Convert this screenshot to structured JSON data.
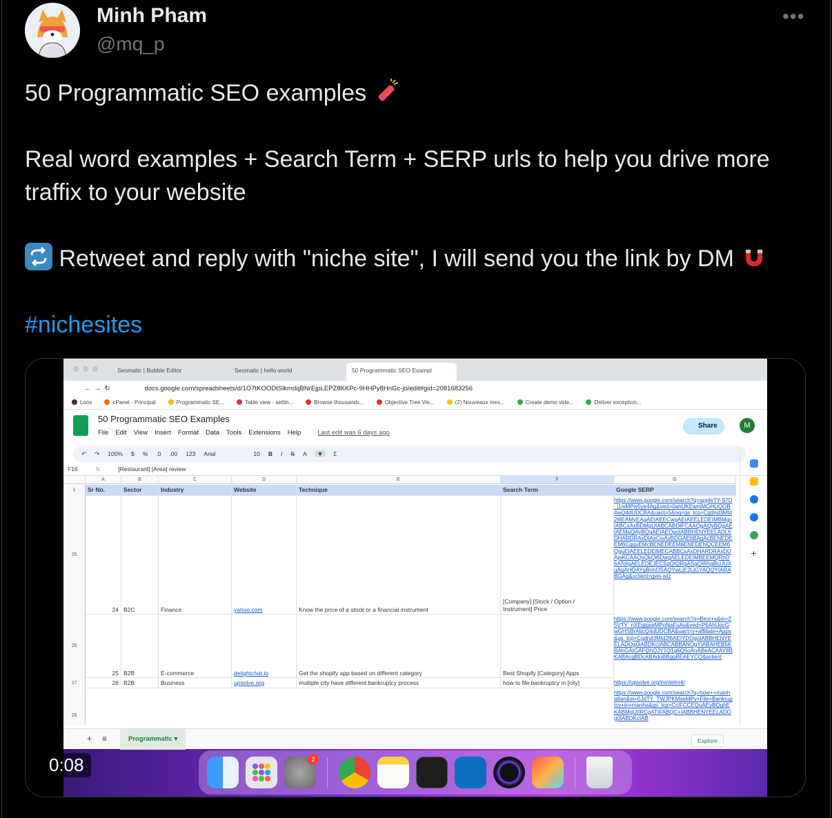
{
  "author": {
    "name": "Minh Pham",
    "handle": "@mq_p"
  },
  "more_icon": "ellipsis-icon",
  "tweet": {
    "line1": "50 Programmatic SEO examples",
    "line2": "Real word examples + Search Term + SERP urls to help you drive more",
    "line3": "traffix to your website",
    "line4": "Retweet and reply with \"niche site\", I will send you the link by DM",
    "hashtag": "#nichesites"
  },
  "video": {
    "time": "0:08"
  },
  "browser": {
    "tabs": [
      "Seomatic | Bubble Editor",
      "Seomatic | hello-world",
      "50 Programmatic SEO Exampl"
    ],
    "url": "docs.google.com/spreadsheets/d/1O7tKOODtSlkmdqBNrEjpLEPZ8KKPc-9HHPy8HnGc-jo/edit#gid=2081683256",
    "bookmarks": [
      "Loox",
      "cPanel - Principal",
      "Programmatic SE...",
      "Table view - settin...",
      "Browse thousands...",
      "Objective Tree Vie...",
      "(2) Nouveaux mes...",
      "Create demo vide...",
      "Deliver exception..."
    ]
  },
  "sheet": {
    "title": "50 Programmatic SEO Examples",
    "menus": [
      "File",
      "Edit",
      "View",
      "Insert",
      "Format",
      "Data",
      "Tools",
      "Extensions",
      "Help"
    ],
    "last_edit": "Last edit was 6 days ago",
    "share_label": "Share",
    "account_initial": "M",
    "toolbar": {
      "zoom": "100%",
      "currency": "$",
      "percent": "%",
      "dec1": ".0",
      "dec2": ".00",
      "format": "123",
      "font": "Arial",
      "size": "10"
    },
    "cell_ref": "F16",
    "formula": "[Restaurant] [Area] review",
    "col_letters": [
      "A",
      "B",
      "C",
      "D",
      "E",
      "F",
      "G"
    ],
    "headers": [
      "Sr No.",
      "Sector",
      "Industry",
      "Website",
      "Technique",
      "Search Term",
      "Google SERP"
    ],
    "row_numbers": [
      "1",
      "25",
      "26",
      "27",
      "28"
    ],
    "rows": [
      {
        "sr": "24",
        "sector": "B2C",
        "industry": "Finance",
        "website": "yahoo.com",
        "technique": "Know the price of a stock or a financial instrument",
        "term1": "[Company] [Stock / Option /",
        "term2": "Instrument] Price",
        "serp": "https://www.google.com/search?q=appleTY-S7D_j1isMPw5ye4Ag&ved=0ahUKEwmMGHUQOB4wQ4dUDCBA&uact=5&oq=gs_lcp=Cgdnd3Mtd2l6EAMyEAgAEIAEECwgAEIAEELEDEIMBMgcIABCxAxBDMgUIABCABDIFCAAQgAQyBQgAEIAEMgQAyBQgAEIAEOgoIABBHENYEELADLhDHARDRAxDIAxCwAxBDGAE6BAgAcBENEDEEM6CgguEMcBENEDEEM6ENEDENQCEEM6QguEIAEELEDEIMECABBCxAxDHARDRAxDUAjoKCAAQsQkQl6DwgAELEDEIMBEEMQRhD6AToIgAELEDEJECSgQIQRgASgQIRhgBUJUXgAgAHQAYgBnhOSAQYwLjE2LjGYAQQYIARABGAg&sclient=gws-wiz"
      },
      {
        "sr": "25",
        "sector": "B2B",
        "industry": "E-commerce",
        "website": "delightchat.io",
        "technique": "Get the shopify app based on different category",
        "term1": "Best Shopify [Category] Apps",
        "term2": "",
        "serp": "https://www.google.com/search?q=Best+s&ei=Z5VTY_nXEgjgseMPoNaFuAs&ved=P6AhUocGwGHSBrAbcQ4dUDCBA&uact=y+affiliate+Apps&gs_lcp=Cgdnd3Mtd2l6AEIYDOgoIABBHENYEELADOg0IABDKcIABCABBANOgYIABAHEB5KBAhGAIGAFQhQJY1Q1g6Q5oAnABeACAAY8BKABAcgBDcABAdoBBggBEAEYCQ&sclient"
      },
      {
        "sr": "26",
        "sector": "B2B",
        "industry": "Business",
        "website": "upsolve.org",
        "technique": "multiple city have different bankruptcy process",
        "term1": "how to file bankruptcy in [city]",
        "term2": "",
        "serp": "https://upsolve.org/mi/detroit/"
      },
      {
        "serp": "https://www.google.com/search?q=how++manhattan&ei=0JdTY_TWJPKMseMPv+File+Bankruptcy+in+manha&gs_lcp=CclFCCEQoAEyBQghEKABMgUIIRCgATIFABQC+IABBHENYEELADOg0IABDKcIAB"
      }
    ],
    "sheet_tab": "Programmatic",
    "explore_label": "Explore"
  },
  "dock": {
    "apps": [
      "finder-icon",
      "launchpad-icon",
      "system-settings-icon",
      "chrome-icon",
      "notes-icon",
      "terminal-icon",
      "vscode-icon",
      "obs-icon",
      "photo-booth-icon",
      "trash-icon"
    ],
    "settings_badge": "2"
  },
  "colors": {
    "accent": "#1d9bf0",
    "sheets_green": "#0f9d58",
    "header_blue": "#c9daf8"
  }
}
